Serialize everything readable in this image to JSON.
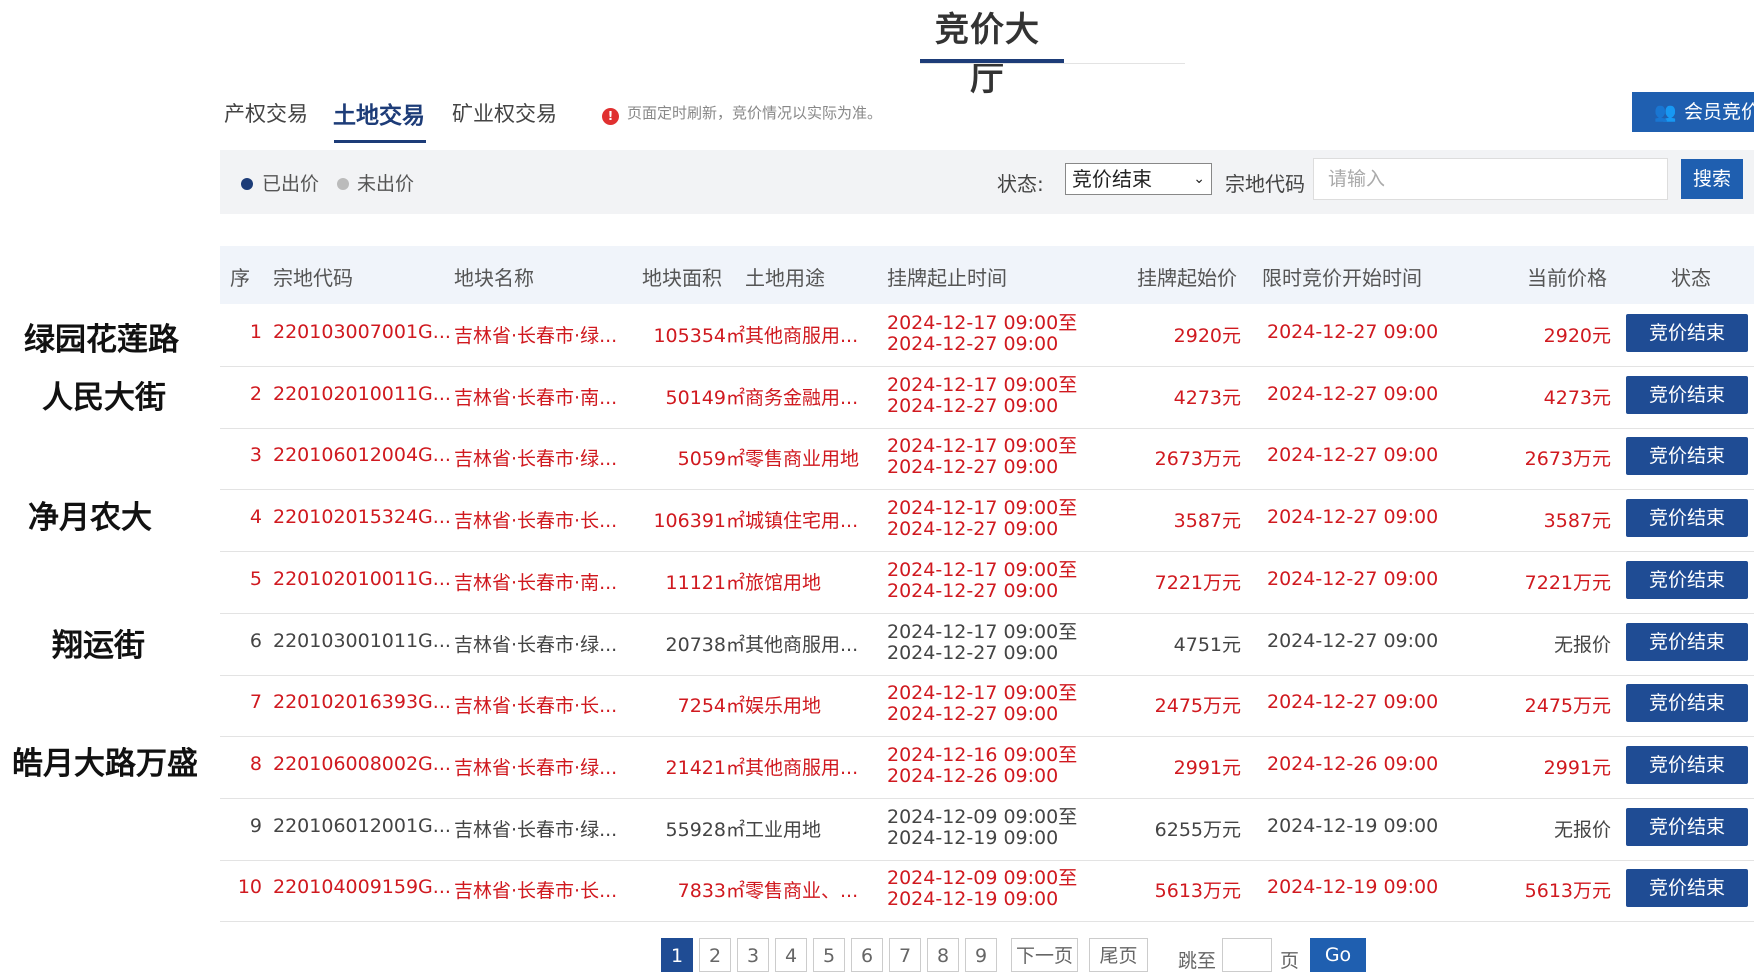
{
  "page_title": "竞价大厅",
  "tabs": [
    {
      "label": "产权交易"
    },
    {
      "label": "土地交易"
    },
    {
      "label": "矿业权交易"
    }
  ],
  "notice": {
    "icon": "info-icon",
    "text": "页面定时刷新，竞价情况以实际为准。"
  },
  "member_button": {
    "icon": "member-icon",
    "label": "会员竞价"
  },
  "legend": {
    "bid": {
      "label": "已出价",
      "color": "#1d3c78"
    },
    "not_bid": {
      "label": "未出价",
      "color": "#bbbbbb"
    }
  },
  "filters": {
    "status_label": "状态:",
    "status_value": "竞价结束",
    "code_label": "宗地代码",
    "code_placeholder": "请输入",
    "search_label": "搜索"
  },
  "table": {
    "headers": [
      "序",
      "宗地代码",
      "地块名称",
      "地块面积",
      "土地用途",
      "挂牌起止时间",
      "挂牌起始价",
      "限时竞价开始时间",
      "当前价格",
      "状态"
    ],
    "rows": [
      {
        "no": "1",
        "code": "220103007001G...",
        "name": "吉林省·长春市·绿...",
        "area": "105354㎡",
        "use": "其他商服用...",
        "time_start": "2024-12-17 09:00至",
        "time_end": "2024-12-27 09:00",
        "start_price": "2920元",
        "bid_start": "2024-12-27 09:00",
        "current_price": "2920元",
        "status": "竞价结束",
        "bid": true
      },
      {
        "no": "2",
        "code": "220102010011G...",
        "name": "吉林省·长春市·南...",
        "area": "50149㎡",
        "use": "商务金融用...",
        "time_start": "2024-12-17 09:00至",
        "time_end": "2024-12-27 09:00",
        "start_price": "4273元",
        "bid_start": "2024-12-27 09:00",
        "current_price": "4273元",
        "status": "竞价结束",
        "bid": true
      },
      {
        "no": "3",
        "code": "220106012004G...",
        "name": "吉林省·长春市·绿...",
        "area": "5059㎡",
        "use": "零售商业用地",
        "time_start": "2024-12-17 09:00至",
        "time_end": "2024-12-27 09:00",
        "start_price": "2673万元",
        "bid_start": "2024-12-27 09:00",
        "current_price": "2673万元",
        "status": "竞价结束",
        "bid": true
      },
      {
        "no": "4",
        "code": "220102015324G...",
        "name": "吉林省·长春市·长...",
        "area": "106391㎡",
        "use": "城镇住宅用...",
        "time_start": "2024-12-17 09:00至",
        "time_end": "2024-12-27 09:00",
        "start_price": "3587元",
        "bid_start": "2024-12-27 09:00",
        "current_price": "3587元",
        "status": "竞价结束",
        "bid": true
      },
      {
        "no": "5",
        "code": "220102010011G...",
        "name": "吉林省·长春市·南...",
        "area": "11121㎡",
        "use": "旅馆用地",
        "time_start": "2024-12-17 09:00至",
        "time_end": "2024-12-27 09:00",
        "start_price": "7221万元",
        "bid_start": "2024-12-27 09:00",
        "current_price": "7221万元",
        "status": "竞价结束",
        "bid": true
      },
      {
        "no": "6",
        "code": "220103001011G...",
        "name": "吉林省·长春市·绿...",
        "area": "20738㎡",
        "use": "其他商服用...",
        "time_start": "2024-12-17 09:00至",
        "time_end": "2024-12-27 09:00",
        "start_price": "4751元",
        "bid_start": "2024-12-27 09:00",
        "current_price": "无报价",
        "status": "竞价结束",
        "bid": false
      },
      {
        "no": "7",
        "code": "220102016393G...",
        "name": "吉林省·长春市·长...",
        "area": "7254㎡",
        "use": "娱乐用地",
        "time_start": "2024-12-17 09:00至",
        "time_end": "2024-12-27 09:00",
        "start_price": "2475万元",
        "bid_start": "2024-12-27 09:00",
        "current_price": "2475万元",
        "status": "竞价结束",
        "bid": true
      },
      {
        "no": "8",
        "code": "220106008002G...",
        "name": "吉林省·长春市·绿...",
        "area": "21421㎡",
        "use": "其他商服用...",
        "time_start": "2024-12-16 09:00至",
        "time_end": "2024-12-26 09:00",
        "start_price": "2991元",
        "bid_start": "2024-12-26 09:00",
        "current_price": "2991元",
        "status": "竞价结束",
        "bid": true
      },
      {
        "no": "9",
        "code": "220106012001G...",
        "name": "吉林省·长春市·绿...",
        "area": "55928㎡",
        "use": "工业用地",
        "time_start": "2024-12-09 09:00至",
        "time_end": "2024-12-19 09:00",
        "start_price": "6255万元",
        "bid_start": "2024-12-19 09:00",
        "current_price": "无报价",
        "status": "竞价结束",
        "bid": false
      },
      {
        "no": "10",
        "code": "220104009159G...",
        "name": "吉林省·长春市·长...",
        "area": "7833㎡",
        "use": "零售商业、...",
        "time_start": "2024-12-09 09:00至",
        "time_end": "2024-12-19 09:00",
        "start_price": "5613万元",
        "bid_start": "2024-12-19 09:00",
        "current_price": "5613万元",
        "status": "竞价结束",
        "bid": true
      }
    ]
  },
  "annotations": [
    "绿园花莲路",
    "人民大街",
    "净月农大",
    "翔运街",
    "皓月大路万盛"
  ],
  "pagination": {
    "pages": [
      "1",
      "2",
      "3",
      "4",
      "5",
      "6",
      "7",
      "8",
      "9"
    ],
    "current": "1",
    "next": "下一页",
    "last": "尾页",
    "jump_label": "跳至",
    "page_unit": "页",
    "go": "Go"
  }
}
